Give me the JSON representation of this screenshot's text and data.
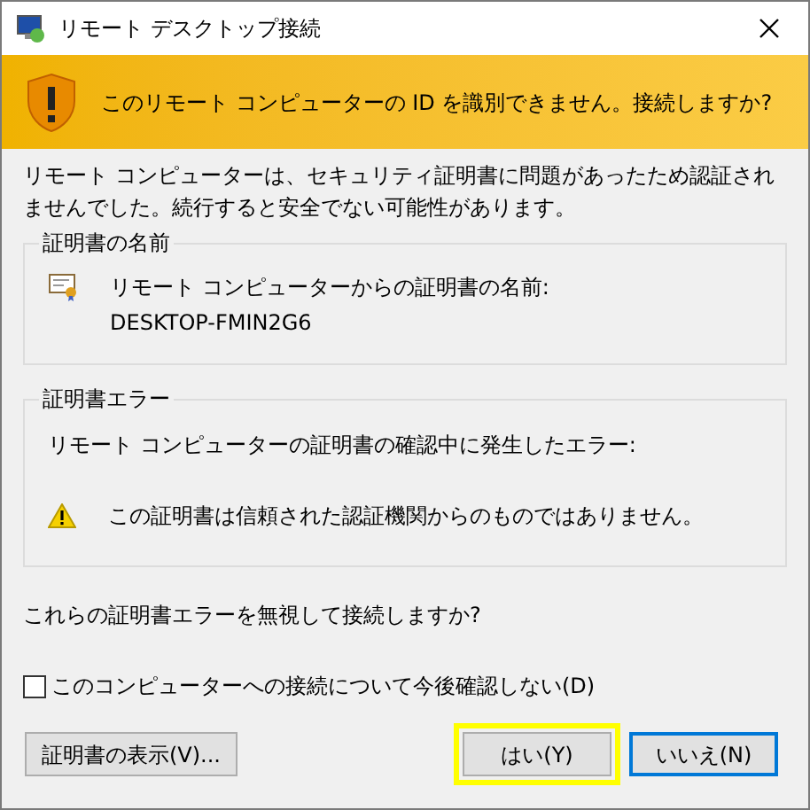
{
  "window": {
    "title": "リモート デスクトップ接続"
  },
  "banner": {
    "text": "このリモート コンピューターの ID を識別できません。接続しますか?"
  },
  "description": "リモート コンピューターは、セキュリティ証明書に問題があったため認証されませんでした。続行すると安全でない可能性があります。",
  "certificate_name_group": {
    "title": "証明書の名前",
    "label": "リモート コンピューターからの証明書の名前:",
    "value": "DESKTOP-FMIN2G6"
  },
  "certificate_error_group": {
    "title": "証明書エラー",
    "intro": "リモート コンピューターの証明書の確認中に発生したエラー:",
    "errors": [
      "この証明書は信頼された認証機関からのものではありません。"
    ]
  },
  "question": "これらの証明書エラーを無視して接続しますか?",
  "dont_ask_checkbox": {
    "label": "このコンピューターへの接続について今後確認しない(D)",
    "checked": false
  },
  "buttons": [
    {
      "label": "証明書の表示(V)...",
      "kind": "secondary",
      "highlighted": false
    },
    {
      "label": "はい(Y)",
      "kind": "secondary",
      "highlighted": true
    },
    {
      "label": "いいえ(N)",
      "kind": "default",
      "highlighted": false
    }
  ]
}
